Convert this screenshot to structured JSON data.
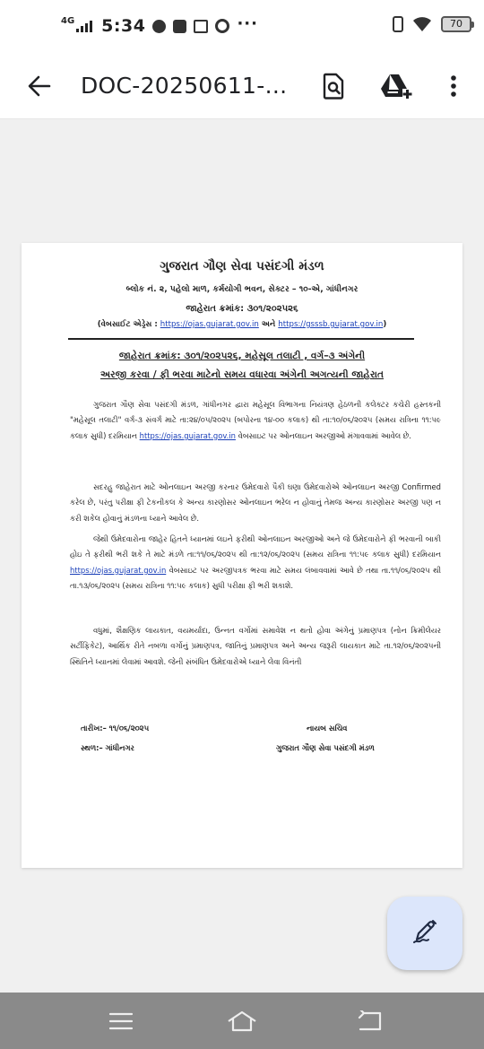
{
  "status_bar": {
    "network": "4G",
    "time": "5:34",
    "battery": "70",
    "more": "···"
  },
  "toolbar": {
    "title": "DOC-20250611-...",
    "icons": [
      "back-arrow-icon",
      "search-document-icon",
      "add-to-drive-icon",
      "more-vert-icon"
    ]
  },
  "document": {
    "org_name": "ગુજરાત ગૌણ સેવા પસંદગી મંડળ",
    "address": "બ્લોક નં. ૨, પહેલો માળ, કર્મયોગી ભવન, સેક્ટર – ૧૦-એ, ગાંધીનગર",
    "notice_no": "જાહેરાત ક્રમાંક: ૩૦૧/૨૦૨૫૨૬",
    "website_prefix": "(વેબસાઈટ એડ્રેસ : ",
    "website1": "https://ojas.gujarat.gov.in",
    "website_and": " અને ",
    "website2": "https://gsssb.gujarat.gov.in",
    "website_suffix": ")",
    "subject_line1": "જાહેરાત ક્રમાંક: ૩૦૧/૨૦૨૫૨૬, મહેસૂલ તલાટી , વર્ગ–૩ અંગેની",
    "subject_line2": "અરજી કરવા / ફી ભરવા માટેનો સમય વધારવા અંગેની અગત્યની જાહેરાત",
    "para1": "ગુજરાત ગૌણ સેવા પસંદગી મંડળ, ગાંધીનગર દ્વારા મહેસૂલ વિભાગના નિયંત્રણ હેઠળની કલેક્ટર કચેરી હસ્તકની \"મહેસૂલ તલાટી\" વર્ગ-૩ સંવર્ગ માટે તા:૨૪/૦૫/૨૦૨૫ (બપોરના ૧૪-૦૦ કલાક) થી તા:૧૦/૦૬/૨૦૨૫ (સમય રાત્રિના ૧૧:૫૯ કલાક સુધી) દરમિયાન",
    "para1_link": "https://ojas.gujarat.gov.in",
    "para1_end": " વેબસાઇટ પર ઓનલાઇન અરજીઓ મંગાવવામાં આવેલ છે.",
    "para2": "સદરહુ જાહેરાત માટે ઓનલાઇન અરજી કરનાર ઉમેદવારો પૈકી ઘણા ઉમેદવારોએ ઓનલાઇન અરજી Confirmed કરેલ છે, પરંતુ પરીક્ષા ફી ટેકનીકલ કે અન્ય કારણોસર ઓનલાઇન ભરેલ ન હોવાનું તેમજ અન્ય કારણોસર અરજી પણ ન કરી શકેલ હોવાનું મંડળના ધ્યાને આવેલ છે.",
    "para3": "જેથી ઉમેદવારોના જાહેર હિતને ધ્યાનમાં લઇને ફરીથી ઓનલાઇન અરજીઓ અને જે ઉમેદવારોને ફી ભરવાની બાકી હોઇ તે ફરીથી ભરી શકે તે માટે મંડળે તા:૧૧/૦૬/૨૦૨૫ થી તા:૧૨/૦૬/૨૦૨૫ (સમય રાત્રિના ૧૧:૫૯ કલાક સુધી) દરમિયાન",
    "para3_link": "https://ojas.gujarat.gov.in",
    "para3_end": " વેબસાઇટ પર અરજીપત્રક ભરવા માટે સમય લંબાવવામાં આવે છે તથા તા.૧૧/૦૬/૨૦૨૫ થી તા.૧૩/૦૬/૨૦૨૫ (સમય રાત્રિના ૧૧:૫૯ કલાક) સુધી પરીક્ષા ફી ભરી શકાશે.",
    "para4": "વધુમાં, શૈક્ષણિક લાયકાત, વયમર્યાદા, ઉન્નત વર્ગોમાં સમાવેશ ન થતો હોવા અંગેનું પ્રમાણપત્ર (નોન ક્રિમીલેયર સર્ટીફિકેટ), આર્થિક રીતે નબળા વર્ગોનું પ્રમાણપત્ર, જાતિનું પ્રમાણપત્ર અને અન્ય જરૂરી લાયકાત માટે તા.૧૨/૦૬/૨૦૨૫ની સ્થિતિને ધ્યાનમાં લેવામાં આવશે. જેની સંબંધિત ઉમેદવારોએ ધ્યાને લેવા વિનંતી",
    "date_label": "તારીખ:– ૧૧/૦૬/૨૦૨૫",
    "place_label": "સ્થળ:– ગાંધીનગર",
    "signatory_title": "નાયબ સચિવ",
    "signatory_org": "ગુજરાત ગૌણ સેવા પસંદગી મંડળ"
  },
  "fab": {
    "icon": "edit-pencil-icon"
  },
  "nav": {
    "icons": [
      "menu-icon",
      "home-icon",
      "back-icon"
    ]
  },
  "colors": {
    "link": "#1a3fb8",
    "fab_bg": "#dce6fb",
    "navbar_bg": "#8a8a8a"
  }
}
